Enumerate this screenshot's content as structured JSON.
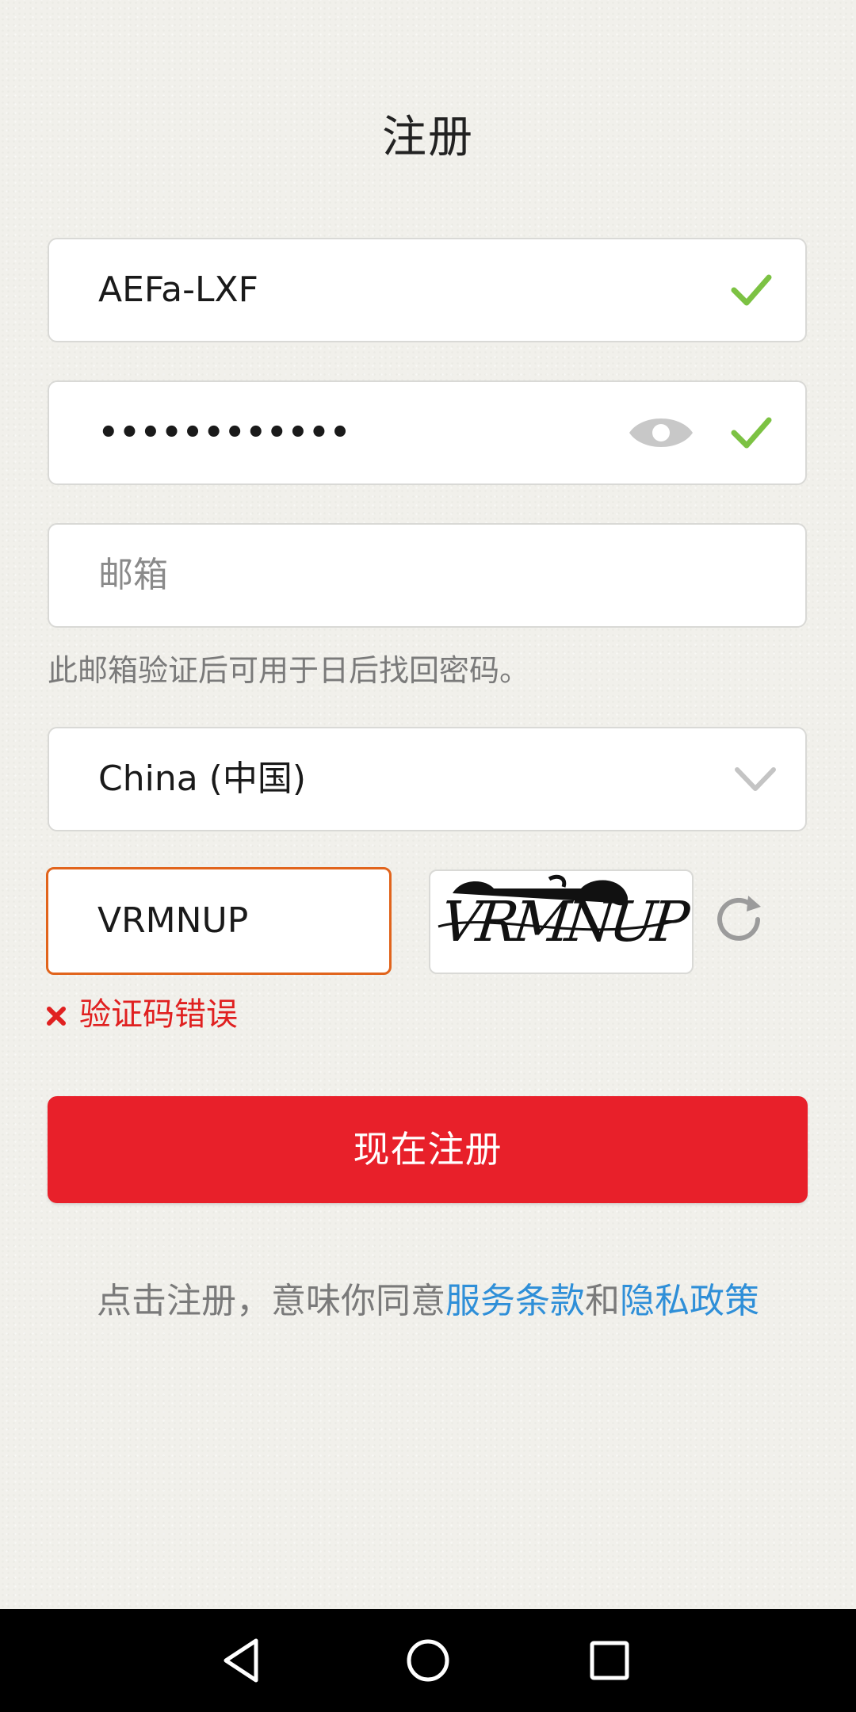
{
  "page": {
    "title": "注册"
  },
  "username": {
    "value": "AEFa-LXF",
    "status_icon": "check-icon"
  },
  "password": {
    "value": "••••••••••••",
    "visibility_icon": "eye-icon",
    "status_icon": "check-icon"
  },
  "email": {
    "placeholder": "邮箱",
    "hint": "此邮箱验证后可用于日后找回密码。"
  },
  "country": {
    "selected": "China (中国)",
    "icon": "chevron-down-icon"
  },
  "captcha": {
    "value": "VRMNUP",
    "image_text": "VRMNUP",
    "refresh_icon": "refresh-icon",
    "error": "验证码错误"
  },
  "register_button": {
    "label": "现在注册"
  },
  "terms": {
    "prefix": "点击注册，意味你同意",
    "service_link": "服务条款",
    "conjunction": "和",
    "privacy_link": "隐私政策"
  },
  "navbar": {
    "back": "back-icon",
    "home": "home-icon",
    "recents": "recents-icon"
  },
  "colors": {
    "accent_red": "#e8202a",
    "check_green": "#7cc243",
    "link_blue": "#2f8fd8",
    "error_red": "#e02020",
    "focus_orange": "#e1641c"
  }
}
